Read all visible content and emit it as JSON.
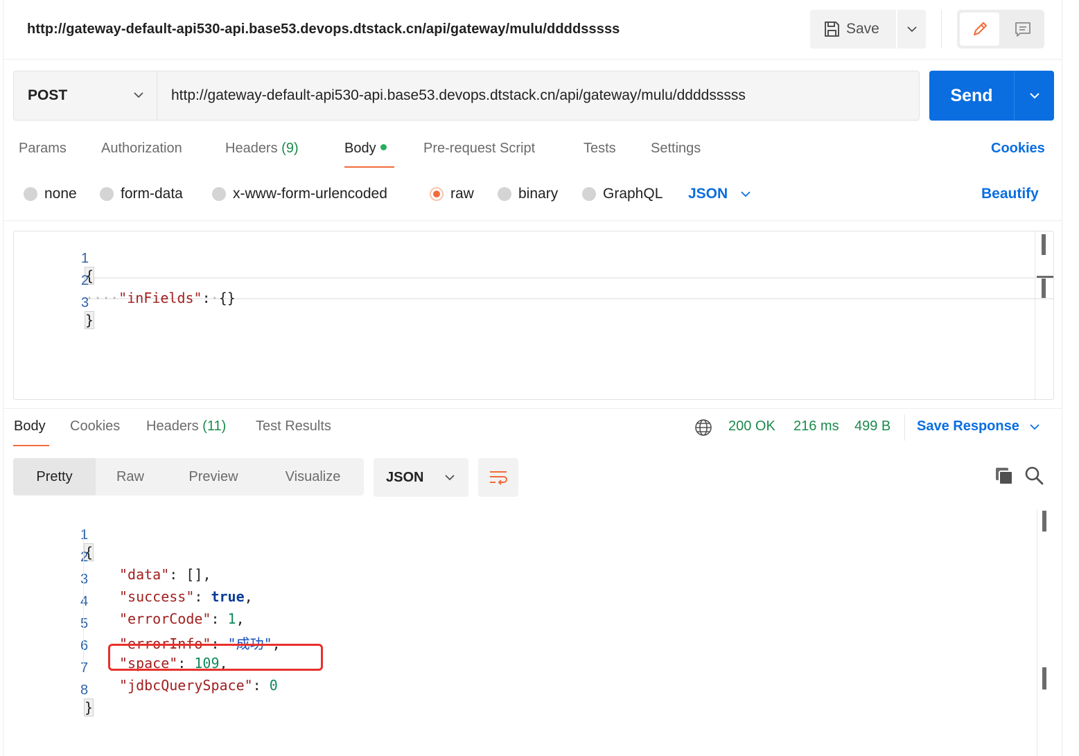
{
  "header": {
    "request_title": "http://gateway-default-api530-api.base53.devops.dtstack.cn/api/gateway/mulu/ddddsssss",
    "save_label": "Save"
  },
  "request": {
    "method": "POST",
    "url": "http://gateway-default-api530-api.base53.devops.dtstack.cn/api/gateway/mulu/ddddsssss",
    "send_label": "Send"
  },
  "request_tabs": {
    "params": "Params",
    "authorization": "Authorization",
    "headers": "Headers",
    "headers_count": "(9)",
    "body": "Body",
    "prerequest": "Pre-request Script",
    "tests": "Tests",
    "settings": "Settings",
    "cookies": "Cookies"
  },
  "body_types": {
    "none": "none",
    "form_data": "form-data",
    "urlencoded": "x-www-form-urlencoded",
    "raw": "raw",
    "binary": "binary",
    "graphql": "GraphQL",
    "selected": "raw",
    "language": "JSON",
    "beautify": "Beautify"
  },
  "request_body": {
    "line_numbers": [
      "1",
      "2",
      "3"
    ],
    "open_brace": "{",
    "close_brace": "}",
    "key": "\"inFields\"",
    "value": "{}"
  },
  "response_tabs": {
    "body": "Body",
    "cookies": "Cookies",
    "headers": "Headers",
    "headers_count": "(11)",
    "test_results": "Test Results"
  },
  "response_status": {
    "status": "200 OK",
    "time": "216 ms",
    "size": "499 B",
    "save_response": "Save Response"
  },
  "response_view": {
    "pretty": "Pretty",
    "raw": "Raw",
    "preview": "Preview",
    "visualize": "Visualize",
    "format": "JSON"
  },
  "response_body": {
    "line_numbers": [
      "1",
      "2",
      "3",
      "4",
      "5",
      "6",
      "7",
      "8"
    ],
    "open_brace": "{",
    "close_brace": "}",
    "fields": [
      {
        "key": "\"data\"",
        "value": "[]",
        "type": "punct",
        "comma": ","
      },
      {
        "key": "\"success\"",
        "value": "true",
        "type": "bool",
        "comma": ","
      },
      {
        "key": "\"errorCode\"",
        "value": "1",
        "type": "num",
        "comma": ","
      },
      {
        "key": "\"errorInfo\"",
        "value": "\"成功\"",
        "type": "str",
        "comma": ","
      },
      {
        "key": "\"space\"",
        "value": "109",
        "type": "num",
        "comma": ","
      },
      {
        "key": "\"jdbcQuerySpace\"",
        "value": "0",
        "type": "num",
        "comma": ""
      }
    ]
  },
  "colors": {
    "accent_blue": "#0a6ee0",
    "status_green": "#1b8a4c",
    "tab_underline": "#f26b3a",
    "highlight_red": "#e8302a"
  }
}
